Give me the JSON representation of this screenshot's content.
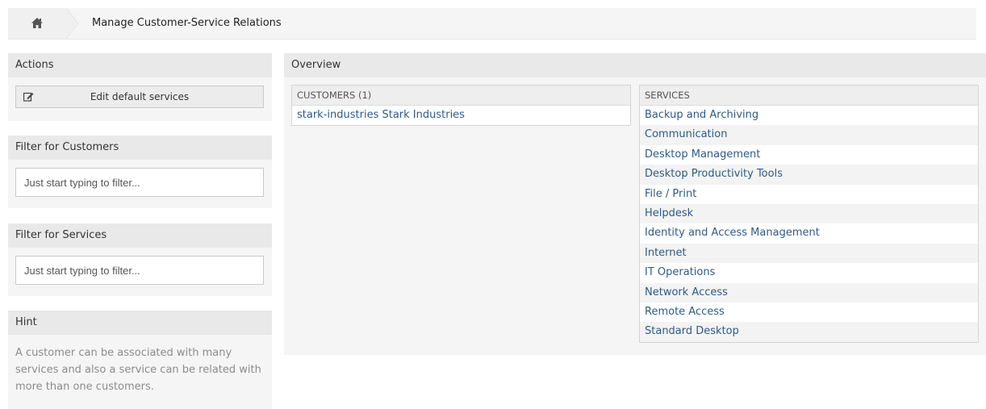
{
  "breadcrumb": {
    "home_icon": "home-icon",
    "title": "Manage Customer-Service Relations"
  },
  "sidebar": {
    "actions": {
      "title": "Actions",
      "edit_default_services_label": "Edit default services",
      "edit_icon": "edit-icon"
    },
    "filter_customers": {
      "title": "Filter for Customers",
      "placeholder": "Just start typing to filter..."
    },
    "filter_services": {
      "title": "Filter for Services",
      "placeholder": "Just start typing to filter..."
    },
    "hint": {
      "title": "Hint",
      "text_line1": "A customer can be associated with many",
      "text_line2": "services and also a service can be related with",
      "text_line3": "more than one customers."
    }
  },
  "overview": {
    "title": "Overview",
    "customers": {
      "header": "CUSTOMERS (1)",
      "rows": [
        "stark-industries Stark Industries"
      ]
    },
    "services": {
      "header": "SERVICES",
      "rows": [
        "Backup and Archiving",
        "Communication",
        "Desktop Management",
        "Desktop Productivity Tools",
        "File / Print",
        "Helpdesk",
        "Identity and Access Management",
        "Internet",
        "IT Operations",
        "Network Access",
        "Remote Access",
        "Standard Desktop"
      ]
    }
  },
  "colors": {
    "link": "#2e5a8a",
    "panel_bg": "#f5f5f5",
    "header_bg": "#e9e9e9",
    "muted_text": "#8c8c8c"
  }
}
